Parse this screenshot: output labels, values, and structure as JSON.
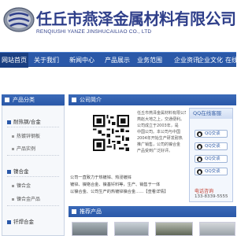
{
  "header": {
    "company_name": "任丘市燕泽金属材料有限公司",
    "company_name_en": "RENQIUSHI YANZE JINSHUCAILIAO CO., LTD"
  },
  "nav": {
    "items": [
      "网站首页",
      "关于我们",
      "新闻中心",
      "产品展示",
      "业务范围",
      "企业资讯",
      "企业文化",
      "在线"
    ]
  },
  "sidebar": {
    "title": "产品分类",
    "categories": [
      {
        "label": "耐热钢/合金",
        "subs": [
          "热镀锌钢板",
          "产品实例"
        ]
      },
      {
        "label": "镍合金",
        "subs": [
          "镍合金",
          "镍合金产品"
        ]
      },
      {
        "label": "钎焊合金",
        "subs": []
      }
    ]
  },
  "about": {
    "title": "公司简介",
    "text_lines": [
      "任丘市燕泽金属材料有限公司位于素",
      "燕赵大地之上，交通便利。",
      "公司成立于2003年，是",
      "中国公司。本公司与中国",
      "2004年开始生产研发耐热",
      "推广销售，公司的镍合金",
      "产品受到广泛好评。"
    ],
    "bottom_lines": [
      "公司一直致力于热镀锌、热浸镀锌",
      "镀锌、镍铬合金、镍基钎料等，生产、销售于一体",
      "以镍合金、公司生产的热镀锌镍合金……【查看详情】"
    ]
  },
  "qq_service": {
    "title": "QQ在线客服",
    "buttons": [
      "QQ交谈",
      "QQ交谈",
      "QQ交谈",
      "QQ交谈"
    ],
    "phone_label": "电话咨询",
    "phone_number": "133-8339-5555"
  },
  "products": {
    "title": "推荐产品"
  },
  "colors": {
    "nav_blue": "#2a58a8",
    "title_navy": "#2f3f8a",
    "nav_active": "#1a3f82"
  }
}
